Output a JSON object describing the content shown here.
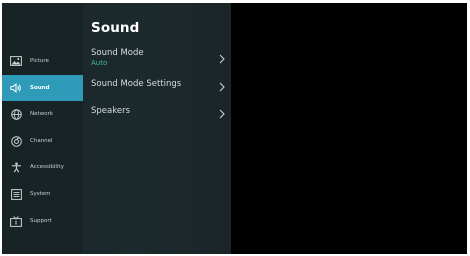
{
  "sidebar": {
    "items": [
      {
        "label": "Picture",
        "icon": "picture-icon"
      },
      {
        "label": "Sound",
        "icon": "speaker-icon",
        "active": true
      },
      {
        "label": "Network",
        "icon": "globe-icon"
      },
      {
        "label": "Channel",
        "icon": "channel-icon"
      },
      {
        "label": "Accessibility",
        "icon": "accessibility-icon"
      },
      {
        "label": "System",
        "icon": "system-icon"
      },
      {
        "label": "Support",
        "icon": "support-icon"
      }
    ]
  },
  "main": {
    "title": "Sound",
    "options": [
      {
        "label": "Sound Mode",
        "value": "Auto"
      },
      {
        "label": "Sound Mode Settings"
      },
      {
        "label": "Speakers"
      }
    ]
  },
  "colors": {
    "accent": "#2e9bb8",
    "value_green": "#3fbf8f",
    "panel_bg": "#1d2a2d",
    "screen_bg": "#000000"
  }
}
